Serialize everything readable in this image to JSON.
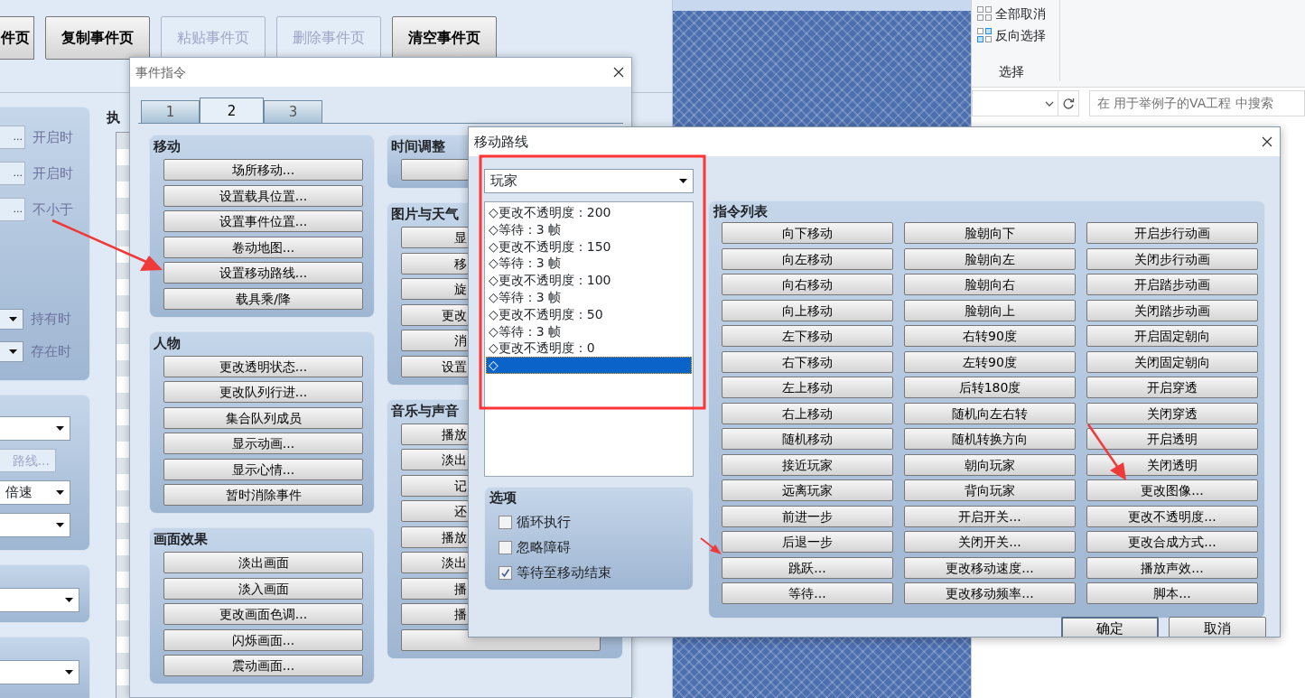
{
  "explorer": {
    "ribbon_items": [
      {
        "label": "全部取消",
        "kind": "none"
      },
      {
        "label": "反向选择",
        "kind": "invert"
      }
    ],
    "ribbon_group": "选择",
    "search": {
      "placeholder": "在 用于举例子的VA工程 中搜索"
    }
  },
  "event_window": {
    "page_buttons": [
      {
        "label": "件页",
        "disabled": false
      },
      {
        "label": "复制事件页",
        "disabled": false
      },
      {
        "label": "粘贴事件页",
        "disabled": true
      },
      {
        "label": "删除事件页",
        "disabled": true
      },
      {
        "label": "清空事件页",
        "disabled": false
      }
    ],
    "conditions": [
      {
        "kind": "picker",
        "button": "...",
        "label": "开启时",
        "disabled": true
      },
      {
        "kind": "picker",
        "button": "...",
        "label": "开启时",
        "disabled": true
      },
      {
        "kind": "picker",
        "button": "...",
        "label": "不小于",
        "disabled": true
      },
      {
        "kind": "select",
        "label": "持有时",
        "disabled": true
      },
      {
        "kind": "select",
        "label": "存在时",
        "disabled": true
      }
    ],
    "route_group": [
      {
        "kind": "select"
      },
      {
        "kind": "button",
        "label": "路线...",
        "disabled": true
      },
      {
        "kind": "select",
        "value": "倍速"
      },
      {
        "kind": "select"
      }
    ],
    "lower_groups": [
      {
        "kind": "select"
      },
      {
        "kind": "select"
      }
    ],
    "contents_heading": "执"
  },
  "commands_dialog": {
    "title": "事件指令",
    "tabs": [
      {
        "label": "1",
        "selected": false
      },
      {
        "label": "2",
        "selected": true
      },
      {
        "label": "3",
        "selected": false
      }
    ],
    "left_groups": [
      {
        "title": "移动",
        "buttons": [
          {
            "label": "场所移动..."
          },
          {
            "label": "设置载具位置..."
          },
          {
            "label": "设置事件位置..."
          },
          {
            "label": "卷动地图..."
          },
          {
            "label": "设置移动路线..."
          },
          {
            "label": "载具乘/降"
          }
        ]
      },
      {
        "title": "人物",
        "buttons": [
          {
            "label": "更改透明状态..."
          },
          {
            "label": "更改队列行进..."
          },
          {
            "label": "集合队列成员"
          },
          {
            "label": "显示动画..."
          },
          {
            "label": "显示心情..."
          },
          {
            "label": "暂时消除事件"
          }
        ]
      },
      {
        "title": "画面效果",
        "buttons": [
          {
            "label": "淡出画面"
          },
          {
            "label": "淡入画面"
          },
          {
            "label": "更改画面色调..."
          },
          {
            "label": "闪烁画面..."
          },
          {
            "label": "震动画面..."
          }
        ]
      }
    ],
    "right_groups": [
      {
        "title": "时间调整",
        "buttons": [
          {
            "kind": "blank"
          }
        ]
      },
      {
        "title": "图片与天气",
        "buttons": [
          {
            "label": "显"
          },
          {
            "label": "移"
          },
          {
            "label": "旋"
          },
          {
            "label": "更改"
          },
          {
            "label": "消"
          },
          {
            "label": "设置"
          }
        ]
      },
      {
        "title": "音乐与声音",
        "buttons": [
          {
            "label": "播放"
          },
          {
            "label": "淡出"
          },
          {
            "label": "记"
          },
          {
            "label": "还"
          },
          {
            "label": "播放"
          },
          {
            "label": "淡出"
          },
          {
            "label": "播"
          },
          {
            "label": "播"
          },
          {
            "kind": "blank"
          }
        ]
      }
    ]
  },
  "move_route": {
    "title": "移动路线",
    "target": "玩家",
    "route": [
      {
        "text": "◇更改不透明度：200",
        "selected": false
      },
      {
        "text": "◇等待：3 帧",
        "selected": false
      },
      {
        "text": "◇更改不透明度：150",
        "selected": false
      },
      {
        "text": "◇等待：3 帧",
        "selected": false
      },
      {
        "text": "◇更改不透明度：100",
        "selected": false
      },
      {
        "text": "◇等待：3 帧",
        "selected": false
      },
      {
        "text": "◇更改不透明度：50",
        "selected": false
      },
      {
        "text": "◇等待：3 帧",
        "selected": false
      },
      {
        "text": "◇更改不透明度：0",
        "selected": false
      },
      {
        "text": "◇",
        "selected": true
      }
    ],
    "options_heading": "选项",
    "options": [
      {
        "label": "循环执行",
        "checked": false
      },
      {
        "label": "忽略障碍",
        "checked": false
      },
      {
        "label": "等待至移动结束",
        "checked": true
      }
    ],
    "commands_heading": "指令列表",
    "command_columns": [
      [
        "向下移动",
        "向左移动",
        "向右移动",
        "向上移动",
        "左下移动",
        "右下移动",
        "左上移动",
        "右上移动",
        "随机移动",
        "接近玩家",
        "远离玩家",
        "前进一步",
        "后退一步",
        "跳跃...",
        "等待..."
      ],
      [
        "脸朝向下",
        "脸朝向左",
        "脸朝向右",
        "脸朝向上",
        "右转90度",
        "左转90度",
        "后转180度",
        "随机向左右转",
        "随机转换方向",
        "朝向玩家",
        "背向玩家",
        "开启开关...",
        "关闭开关...",
        "更改移动速度...",
        "更改移动频率..."
      ],
      [
        "开启步行动画",
        "关闭步行动画",
        "开启踏步动画",
        "关闭踏步动画",
        "开启固定朝向",
        "关闭固定朝向",
        "开启穿透",
        "关闭穿透",
        "开启透明",
        "关闭透明",
        "更改图像...",
        "更改不透明度...",
        "更改合成方式...",
        "播放声效...",
        "脚本..."
      ]
    ],
    "ok": "确定",
    "cancel": "取消"
  }
}
